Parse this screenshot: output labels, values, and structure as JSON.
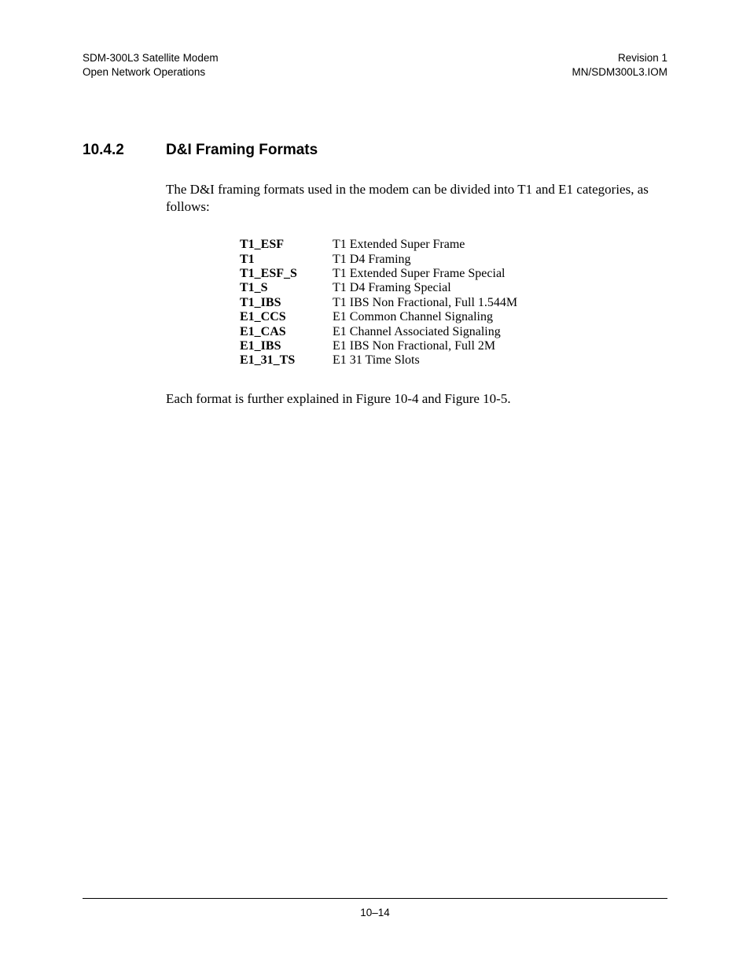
{
  "header": {
    "left_line1": "SDM-300L3 Satellite Modem",
    "left_line2": "Open Network Operations",
    "right_line1": "Revision 1",
    "right_line2": "MN/SDM300L3.IOM"
  },
  "section": {
    "number": "10.4.2",
    "title": "D&I Framing Formats"
  },
  "intro": "The D&I framing formats used in the modem can be divided into T1 and E1 categories, as follows:",
  "formats": [
    {
      "key": "T1_ESF",
      "desc": "T1 Extended Super Frame"
    },
    {
      "key": "T1",
      "desc": "T1 D4 Framing"
    },
    {
      "key": "T1_ESF_S",
      "desc": "T1 Extended Super Frame Special"
    },
    {
      "key": "T1_S",
      "desc": "T1 D4 Framing Special"
    },
    {
      "key": "T1_IBS",
      "desc": "T1 IBS Non Fractional, Full 1.544M"
    },
    {
      "key": "E1_CCS",
      "desc": "E1 Common Channel Signaling"
    },
    {
      "key": "E1_CAS",
      "desc": "E1 Channel Associated Signaling"
    },
    {
      "key": "E1_IBS",
      "desc": "E1 IBS Non Fractional, Full 2M"
    },
    {
      "key": "E1_31_TS",
      "desc": "E1 31 Time Slots"
    }
  ],
  "closing": "Each format is further explained in Figure 10-4 and Figure 10-5.",
  "page_number": "10–14"
}
